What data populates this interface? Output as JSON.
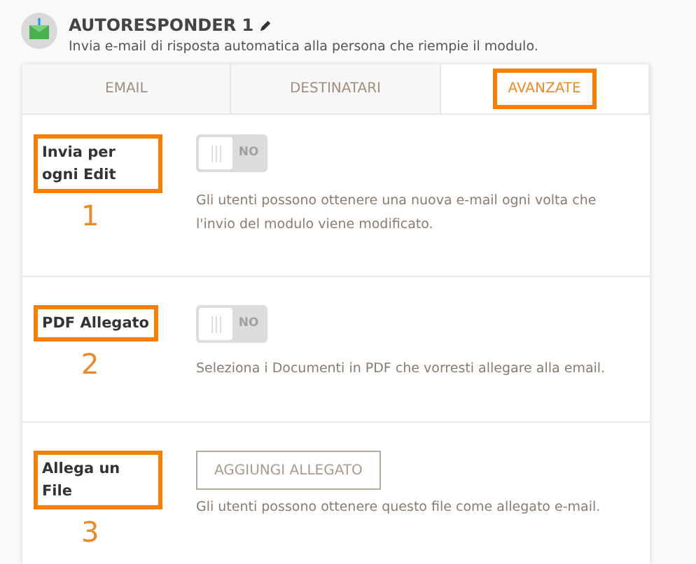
{
  "header": {
    "title": "AUTORESPONDER 1",
    "subtitle": "Invia e-mail di risposta automatica alla persona che riempie il modulo."
  },
  "tabs": [
    {
      "label": "EMAIL",
      "selected": false,
      "highlighted": false
    },
    {
      "label": "DESTINATARI",
      "selected": false,
      "highlighted": false
    },
    {
      "label": "AVANZATE",
      "selected": true,
      "highlighted": true
    }
  ],
  "rows": [
    {
      "kind": "toggle",
      "label": "Invia per ogni Edit",
      "number": "1",
      "on": false,
      "toggle_text": "NO",
      "description": "Gli utenti possono ottenere una nuova e-mail ogni volta che l'invio del modulo viene modificato."
    },
    {
      "kind": "toggle",
      "label": "PDF Allegato",
      "number": "2",
      "on": false,
      "toggle_text": "NO",
      "description": "Seleziona i Documenti in PDF che vorresti allegare alla email."
    },
    {
      "kind": "button",
      "label": "Allega un File",
      "number": "3",
      "button_text": "AGGIUNGI ALLEGATO",
      "description": "Gli utenti possono ottenere questo file come allegato e-mail."
    }
  ]
}
